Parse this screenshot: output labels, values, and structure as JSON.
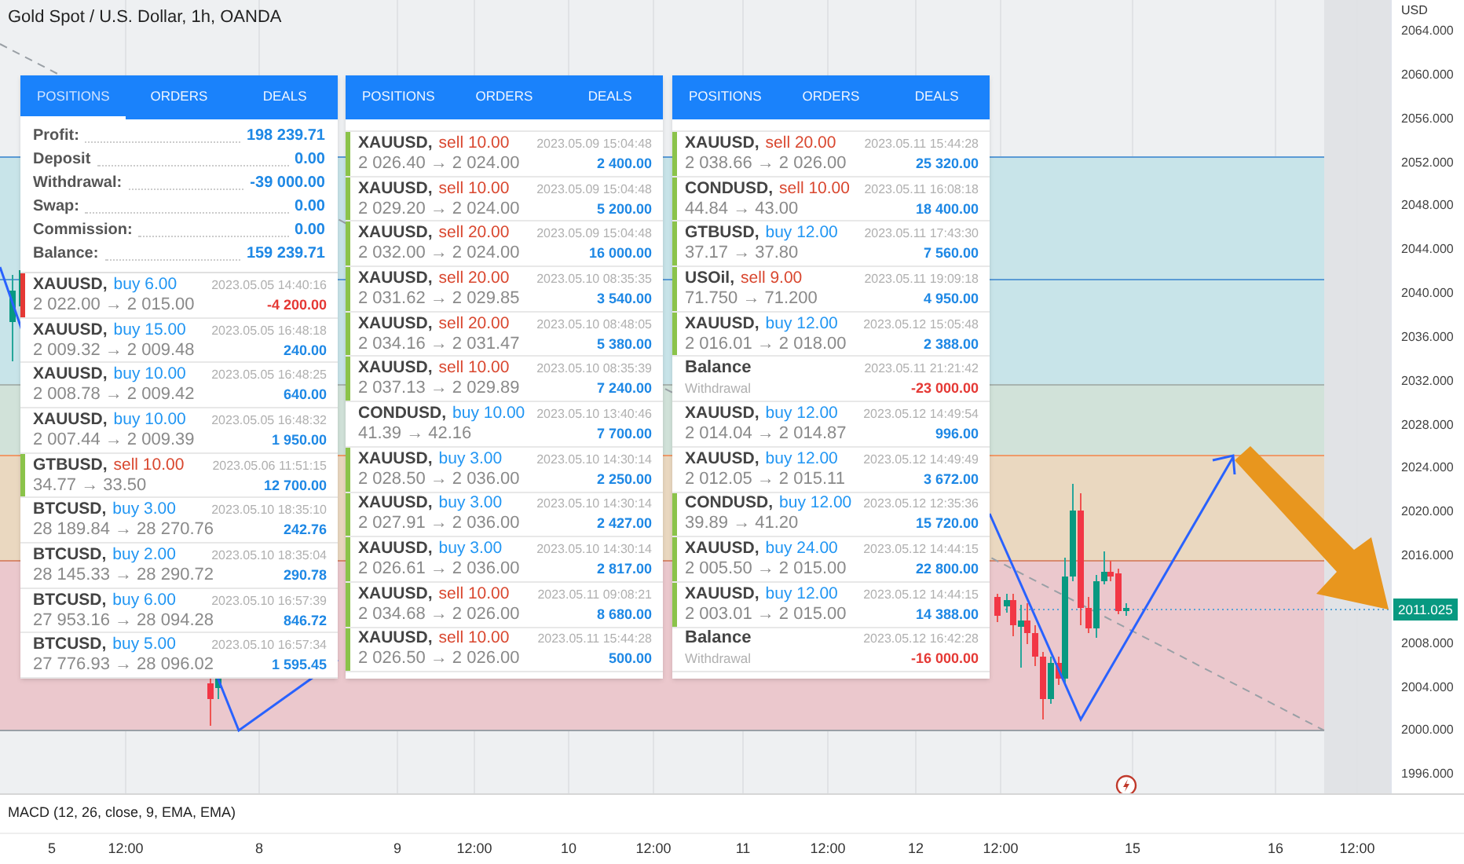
{
  "chart": {
    "title": "Gold Spot / U.S. Dollar, 1h, OANDA",
    "currency": "USD",
    "price_ticks": [
      "2064.000",
      "2060.000",
      "2056.000",
      "2052.000",
      "2048.000",
      "2044.000",
      "2040.000",
      "2036.000",
      "2032.000",
      "2028.000",
      "2024.000",
      "2020.000",
      "2016.000",
      "2008.000",
      "2004.000",
      "2000.000",
      "1996.000"
    ],
    "last_price": "2011.025",
    "indicator": "MACD (12, 26, close, 9, EMA, EMA)",
    "time_ticks": [
      "5",
      "12:00",
      "8",
      "9",
      "12:00",
      "10",
      "12:00",
      "11",
      "12:00",
      "12",
      "12:00",
      "15",
      "16",
      "12:00"
    ]
  },
  "panels": [
    {
      "tabs": [
        {
          "label": "POSITIONS",
          "selected": true
        },
        {
          "label": "ORDERS",
          "selected": false
        },
        {
          "label": "DEALS",
          "selected": false
        }
      ],
      "summary": [
        {
          "label": "Profit:",
          "value": "198 239.71"
        },
        {
          "label": "Deposit",
          "value": "0.00"
        },
        {
          "label": "Withdrawal:",
          "value": "-39 000.00"
        },
        {
          "label": "Swap:",
          "value": "0.00"
        },
        {
          "label": "Commission:",
          "value": "0.00"
        },
        {
          "label": "Balance:",
          "value": "159 239.71"
        }
      ],
      "rows": [
        {
          "kind": "buy",
          "symbol": "XAUUSD,",
          "order": "buy 6.00",
          "prices": "2 022.00 → 2 015.00",
          "time": "2023.05.05 14:40:16",
          "amount": "-4 200.00",
          "negative": true,
          "color": "#e53935"
        },
        {
          "kind": "buy",
          "symbol": "XAUUSD,",
          "order": "buy 15.00",
          "prices": "2 009.32 → 2 009.48",
          "time": "2023.05.05 16:48:18",
          "amount": "240.00",
          "negative": false
        },
        {
          "kind": "buy",
          "symbol": "XAUUSD,",
          "order": "buy 10.00",
          "prices": "2 008.78 → 2 009.42",
          "time": "2023.05.05 16:48:25",
          "amount": "640.00",
          "negative": false
        },
        {
          "kind": "buy",
          "symbol": "XAUUSD,",
          "order": "buy 10.00",
          "prices": "2 007.44 → 2 009.39",
          "time": "2023.05.05 16:48:32",
          "amount": "1 950.00",
          "negative": false
        },
        {
          "kind": "sell",
          "symbol": "GTBUSD,",
          "order": "sell 10.00",
          "prices": "34.77 → 33.50",
          "time": "2023.05.06 11:51:15",
          "amount": "12 700.00",
          "negative": false,
          "color": "#8bc34a"
        },
        {
          "kind": "buy",
          "symbol": "BTCUSD,",
          "order": "buy 3.00",
          "prices": "28 189.84 → 28 270.76",
          "time": "2023.05.10 18:35:10",
          "amount": "242.76",
          "negative": false
        },
        {
          "kind": "buy",
          "symbol": "BTCUSD,",
          "order": "buy 2.00",
          "prices": "28 145.33 → 28 290.72",
          "time": "2023.05.10 18:35:04",
          "amount": "290.78",
          "negative": false
        },
        {
          "kind": "buy",
          "symbol": "BTCUSD,",
          "order": "buy 6.00",
          "prices": "27 953.16 → 28 094.28",
          "time": "2023.05.10 16:57:39",
          "amount": "846.72",
          "negative": false
        },
        {
          "kind": "buy",
          "symbol": "BTCUSD,",
          "order": "buy 5.00",
          "prices": "27 776.93 → 28 096.02",
          "time": "2023.05.10 16:57:34",
          "amount": "1 595.45",
          "negative": false
        }
      ]
    },
    {
      "tabs": [
        {
          "label": "POSITIONS",
          "selected": false
        },
        {
          "label": "ORDERS",
          "selected": false
        },
        {
          "label": "DEALS",
          "selected": false
        }
      ],
      "rows": [
        {
          "kind": "sell",
          "symbol": "XAUUSD,",
          "order": "sell 10.00",
          "prices": "2 026.40 → 2 024.00",
          "time": "2023.05.09 15:04:48",
          "amount": "2 400.00",
          "negative": false,
          "color": "#8bc34a"
        },
        {
          "kind": "sell",
          "symbol": "XAUUSD,",
          "order": "sell 10.00",
          "prices": "2 029.20 → 2 024.00",
          "time": "2023.05.09 15:04:48",
          "amount": "5 200.00",
          "negative": false,
          "color": "#8bc34a"
        },
        {
          "kind": "sell",
          "symbol": "XAUUSD,",
          "order": "sell 20.00",
          "prices": "2 032.00 → 2 024.00",
          "time": "2023.05.09 15:04:48",
          "amount": "16 000.00",
          "negative": false,
          "color": "#8bc34a"
        },
        {
          "kind": "sell",
          "symbol": "XAUUSD,",
          "order": "sell 20.00",
          "prices": "2 031.62 → 2 029.85",
          "time": "2023.05.10 08:35:35",
          "amount": "3 540.00",
          "negative": false,
          "color": "#8bc34a"
        },
        {
          "kind": "sell",
          "symbol": "XAUUSD,",
          "order": "sell 20.00",
          "prices": "2 034.16 → 2 031.47",
          "time": "2023.05.10 08:48:05",
          "amount": "5 380.00",
          "negative": false,
          "color": "#8bc34a"
        },
        {
          "kind": "sell",
          "symbol": "XAUUSD,",
          "order": "sell 10.00",
          "prices": "2 037.13 → 2 029.89",
          "time": "2023.05.10 08:35:39",
          "amount": "7 240.00",
          "negative": false,
          "color": "#8bc34a"
        },
        {
          "kind": "buy",
          "symbol": "CONDUSD,",
          "order": "buy 10.00",
          "prices": "41.39 → 42.16",
          "time": "2023.05.10 13:40:46",
          "amount": "7 700.00",
          "negative": false
        },
        {
          "kind": "buy",
          "symbol": "XAUUSD,",
          "order": "buy 3.00",
          "prices": "2 028.50 → 2 036.00",
          "time": "2023.05.10 14:30:14",
          "amount": "2 250.00",
          "negative": false,
          "color": "#8bc34a"
        },
        {
          "kind": "buy",
          "symbol": "XAUUSD,",
          "order": "buy 3.00",
          "prices": "2 027.91 → 2 036.00",
          "time": "2023.05.10 14:30:14",
          "amount": "2 427.00",
          "negative": false,
          "color": "#8bc34a"
        },
        {
          "kind": "buy",
          "symbol": "XAUUSD,",
          "order": "buy 3.00",
          "prices": "2 026.61 → 2 036.00",
          "time": "2023.05.10 14:30:14",
          "amount": "2 817.00",
          "negative": false,
          "color": "#8bc34a"
        },
        {
          "kind": "sell",
          "symbol": "XAUUSD,",
          "order": "sell 10.00",
          "prices": "2 034.68 → 2 026.00",
          "time": "2023.05.11 09:08:21",
          "amount": "8 680.00",
          "negative": false,
          "color": "#8bc34a"
        },
        {
          "kind": "sell",
          "symbol": "XAUUSD,",
          "order": "sell 10.00",
          "prices": "2 026.50 → 2 026.00",
          "time": "2023.05.11 15:44:28",
          "amount": "500.00",
          "negative": false,
          "color": "#8bc34a"
        }
      ]
    },
    {
      "tabs": [
        {
          "label": "POSITIONS",
          "selected": false
        },
        {
          "label": "ORDERS",
          "selected": false
        },
        {
          "label": "DEALS",
          "selected": false
        }
      ],
      "rows": [
        {
          "kind": "sell",
          "symbol": "XAUUSD,",
          "order": "sell 20.00",
          "prices": "2 038.66 → 2 026.00",
          "time": "2023.05.11 15:44:28",
          "amount": "25 320.00",
          "negative": false,
          "color": "#8bc34a"
        },
        {
          "kind": "sell",
          "symbol": "CONDUSD,",
          "order": "sell 10.00",
          "prices": "44.84 → 43.00",
          "time": "2023.05.11 16:08:18",
          "amount": "18 400.00",
          "negative": false,
          "color": "#8bc34a"
        },
        {
          "kind": "buy",
          "symbol": "GTBUSD,",
          "order": "buy 12.00",
          "prices": "37.17 → 37.80",
          "time": "2023.05.11 17:43:30",
          "amount": "7 560.00",
          "negative": false,
          "color": "#8bc34a"
        },
        {
          "kind": "sell",
          "symbol": "USOil,",
          "order": "sell 9.00",
          "prices": "71.750 → 71.200",
          "time": "2023.05.11 19:09:18",
          "amount": "4 950.00",
          "negative": false,
          "color": "#8bc34a"
        },
        {
          "kind": "buy",
          "symbol": "XAUUSD,",
          "order": "buy 12.00",
          "prices": "2 016.01 → 2 018.00",
          "time": "2023.05.12 15:05:48",
          "amount": "2 388.00",
          "negative": false,
          "color": "#8bc34a"
        },
        {
          "kind": "balance",
          "symbol": "Balance",
          "note": "Withdrawal",
          "time": "2023.05.11 21:21:42",
          "amount": "-23 000.00",
          "negative": true
        },
        {
          "kind": "buy",
          "symbol": "XAUUSD,",
          "order": "buy 12.00",
          "prices": "2 014.04 → 2 014.87",
          "time": "2023.05.12 14:49:54",
          "amount": "996.00",
          "negative": false
        },
        {
          "kind": "buy",
          "symbol": "XAUUSD,",
          "order": "buy 12.00",
          "prices": "2 012.05 → 2 015.11",
          "time": "2023.05.12 14:49:49",
          "amount": "3 672.00",
          "negative": false
        },
        {
          "kind": "buy",
          "symbol": "CONDUSD,",
          "order": "buy 12.00",
          "prices": "39.89 → 41.20",
          "time": "2023.05.12 12:35:36",
          "amount": "15 720.00",
          "negative": false,
          "color": "#8bc34a"
        },
        {
          "kind": "buy",
          "symbol": "XAUUSD,",
          "order": "buy 24.00",
          "prices": "2 005.50 → 2 015.00",
          "time": "2023.05.12 14:44:15",
          "amount": "22 800.00",
          "negative": false,
          "color": "#8bc34a"
        },
        {
          "kind": "buy",
          "symbol": "XAUUSD,",
          "order": "buy 12.00",
          "prices": "2 003.01 → 2 015.00",
          "time": "2023.05.12 14:44:15",
          "amount": "14 388.00",
          "negative": false,
          "color": "#8bc34a"
        },
        {
          "kind": "balance",
          "symbol": "Balance",
          "note": "Withdrawal",
          "time": "2023.05.12 16:42:28",
          "amount": "-16 000.00",
          "negative": true
        }
      ]
    }
  ]
}
